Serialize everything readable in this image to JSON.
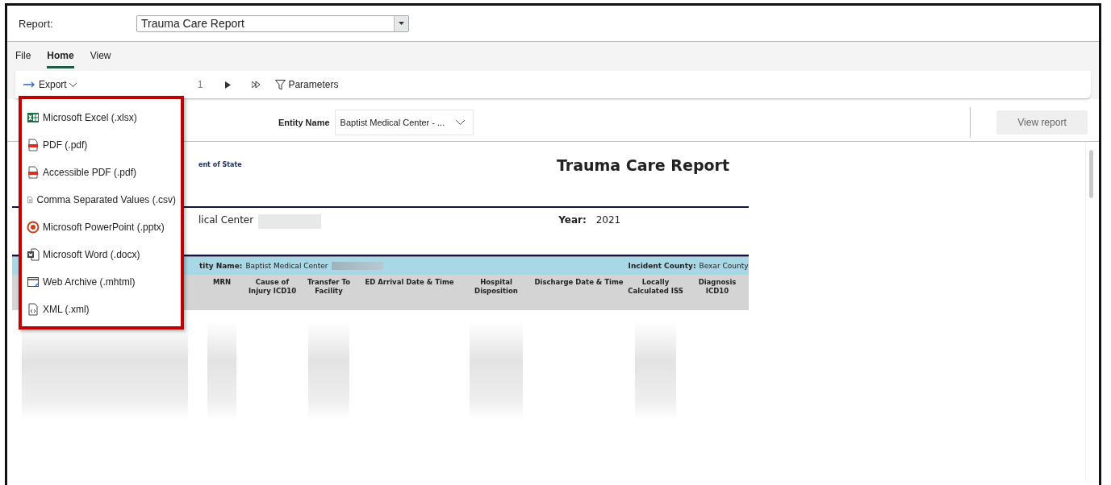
{
  "report_selector": {
    "label": "Report:",
    "value": "Trauma Care Report"
  },
  "ribbon_tabs": [
    {
      "label": "File",
      "selected": false
    },
    {
      "label": "Home",
      "selected": true
    },
    {
      "label": "View",
      "selected": false
    }
  ],
  "toolbar": {
    "export": "Export",
    "page": "1",
    "parameters": "Parameters"
  },
  "export_menu": {
    "items": [
      {
        "kind": "excel",
        "label": "Microsoft Excel (.xlsx)"
      },
      {
        "kind": "pdf",
        "label": "PDF (.pdf)"
      },
      {
        "kind": "pdf",
        "label": "Accessible PDF (.pdf)"
      },
      {
        "kind": "csv",
        "label": "Comma Separated Values (.csv)"
      },
      {
        "kind": "powerpoint",
        "label": "Microsoft PowerPoint (.pptx)"
      },
      {
        "kind": "word",
        "label": "Microsoft Word (.docx)"
      },
      {
        "kind": "web",
        "label": "Web Archive (.mhtml)"
      },
      {
        "kind": "xml",
        "label": "XML (.xml)"
      }
    ]
  },
  "parameters": {
    "entity_label": "Entity Name",
    "entity_value": "Baptist Medical Center - ...",
    "view_report": "View report"
  },
  "report": {
    "header_fragment": "ent of State",
    "title": "Trauma Care Report",
    "facility_fragment": "lical Center",
    "year_label": "Year:",
    "year": "2021",
    "band": {
      "facility_label": "tity Name:",
      "facility_value": "Baptist Medical Center",
      "county_label": "Incident County:",
      "county_value": "Bexar County"
    },
    "columns": [
      "MRN",
      "Cause of Injury ICD10",
      "Transfer To Facility",
      "ED Arrival Date & Time",
      "Hospital Disposition",
      "Discharge Date & Time",
      "Locally Calculated ISS",
      "Diagnosis ICD10"
    ]
  }
}
